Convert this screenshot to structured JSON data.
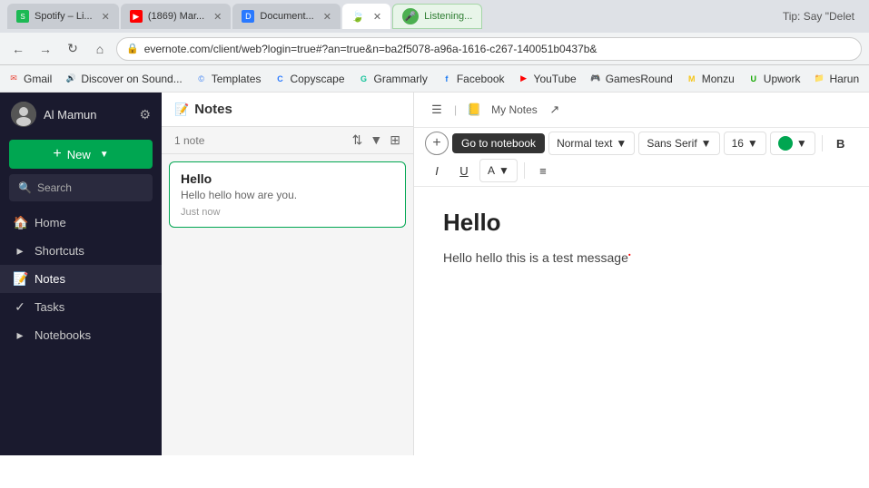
{
  "browser": {
    "tabs": [
      {
        "id": "spotify",
        "title": "Spotify – Li...",
        "favicon_color": "#1db954",
        "favicon_text": "S",
        "active": false
      },
      {
        "id": "youtube",
        "title": "(1869) Mar...",
        "favicon_color": "#ff0000",
        "favicon_text": "▶",
        "active": false
      },
      {
        "id": "document",
        "title": "Document...",
        "favicon_color": "#2979ff",
        "favicon_text": "D",
        "active": false
      },
      {
        "id": "evernote",
        "title": "",
        "favicon_color": "#00a651",
        "favicon_text": "🍃",
        "active": true
      }
    ],
    "listening_tab": {
      "icon": "🎤",
      "text": "Listening...",
      "tip": "Tip: Say \"Delet"
    },
    "address": "evernote.com/client/web?login=true#?an=true&n=ba2f5078-a96a-1616-c267-140051b0437b&",
    "bookmarks": [
      {
        "label": "Gmail",
        "icon": "✉",
        "color": "#ea4335"
      },
      {
        "label": "Discover on Sound...",
        "icon": "🔊",
        "color": "#ff6600"
      },
      {
        "label": "Templates",
        "icon": "©",
        "color": "#4285f4"
      },
      {
        "label": "Copyscape",
        "icon": "C",
        "color": "#2979ff"
      },
      {
        "label": "Grammarly",
        "icon": "G",
        "color": "#15c39a"
      },
      {
        "label": "Facebook",
        "icon": "f",
        "color": "#1877f2"
      },
      {
        "label": "YouTube",
        "icon": "▶",
        "color": "#ff0000"
      },
      {
        "label": "GamesRound",
        "icon": "🎮",
        "color": "#f5c518"
      },
      {
        "label": "Monzu",
        "icon": "M",
        "color": "#f5c518"
      },
      {
        "label": "Upwork",
        "icon": "U",
        "color": "#14a800"
      },
      {
        "label": "Harun",
        "icon": "H",
        "color": "#888"
      }
    ]
  },
  "sidebar": {
    "user_name": "Al Mamun",
    "new_label": "New",
    "search_label": "Search",
    "nav_items": [
      {
        "id": "home",
        "label": "Home",
        "icon": "🏠",
        "active": false
      },
      {
        "id": "shortcuts",
        "label": "Shortcuts",
        "icon": "⚡",
        "active": false
      },
      {
        "id": "notes",
        "label": "Notes",
        "icon": "📝",
        "active": true
      },
      {
        "id": "tasks",
        "label": "Tasks",
        "icon": "✅",
        "active": false
      },
      {
        "id": "notebooks",
        "label": "Notebooks",
        "icon": "📒",
        "active": false
      }
    ]
  },
  "notes_list": {
    "title": "Notes",
    "count": "1 note",
    "notes": [
      {
        "id": "hello",
        "title": "Hello",
        "preview": "Hello hello how are you.",
        "time": "Just now",
        "selected": true
      }
    ]
  },
  "editor": {
    "notebook_path": "My Notes",
    "go_to_notebook_label": "Go to notebook",
    "toolbar": {
      "normal_text_label": "Normal text",
      "font_label": "Sans Serif",
      "size_label": "16",
      "bold_label": "B",
      "italic_label": "I",
      "underline_label": "U",
      "font_color_label": "A",
      "list_label": "≡"
    },
    "note": {
      "title": "Hello",
      "body": "Hello hello this is a test message"
    }
  }
}
